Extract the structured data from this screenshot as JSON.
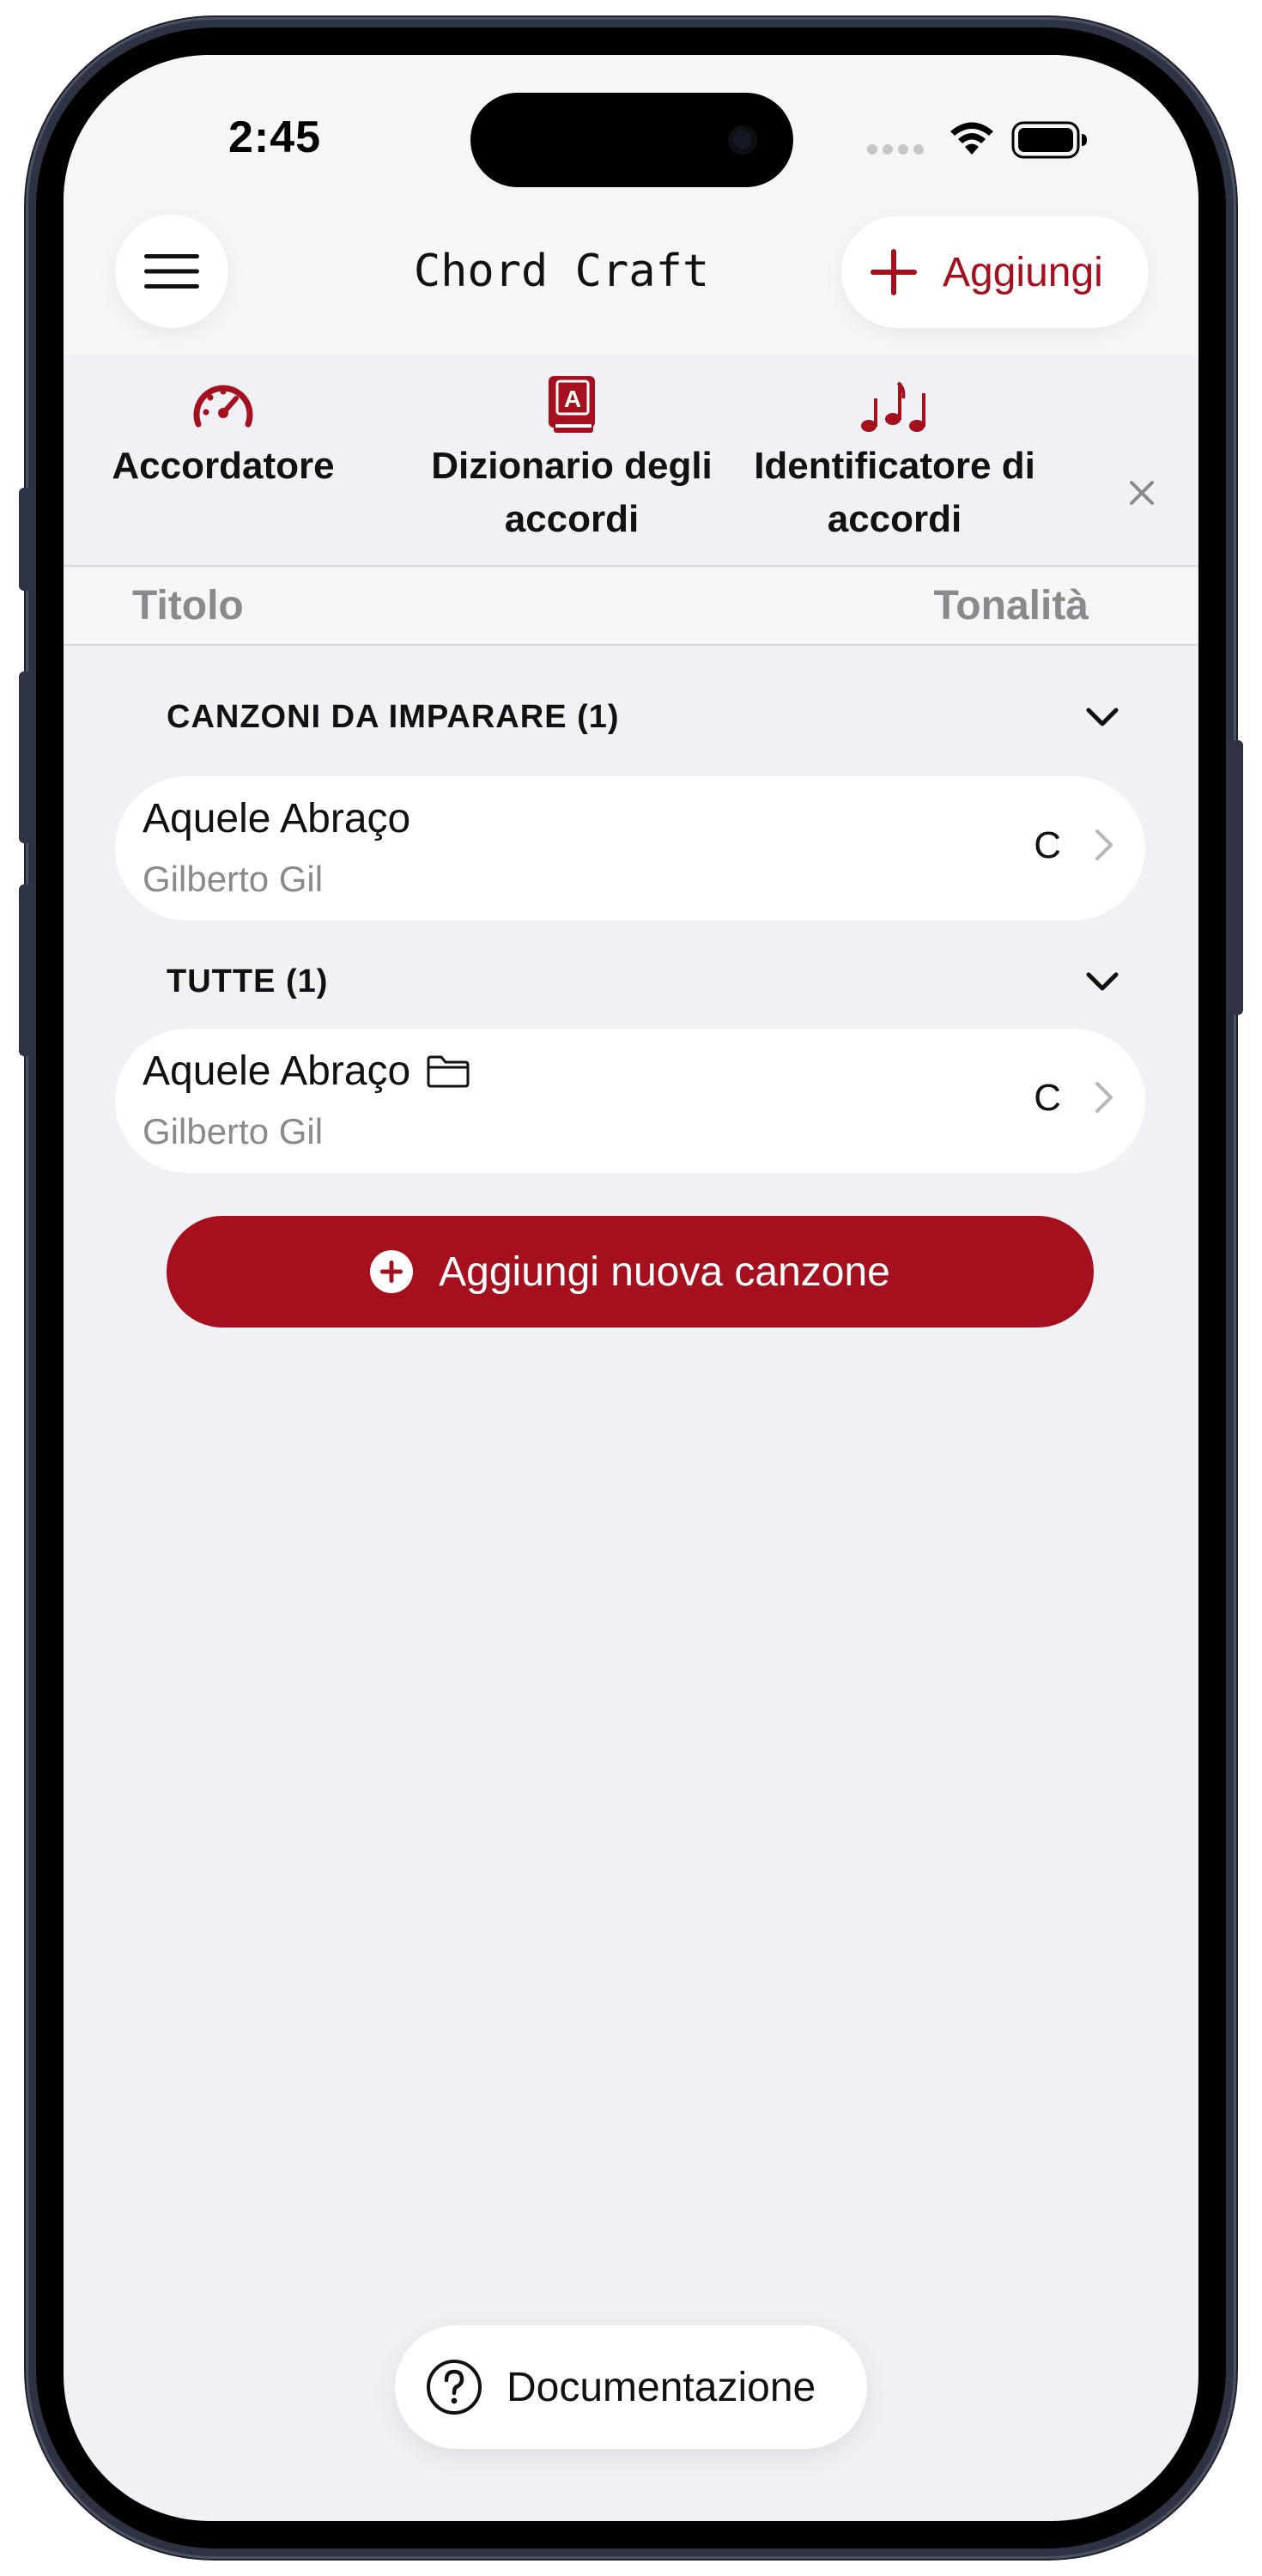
{
  "status_bar": {
    "time": "2:45"
  },
  "header": {
    "title": "Chord Craft",
    "add_label": "Aggiungi",
    "menu_icon": "hamburger-icon",
    "add_icon": "plus-icon"
  },
  "tools": [
    {
      "label_line1": "Accordatore",
      "label_line2": "",
      "icon": "tuner-gauge-icon"
    },
    {
      "label_line1": "Dizionario degli",
      "label_line2": "accordi",
      "icon": "chord-book-icon"
    },
    {
      "label_line1": "Identificatore di",
      "label_line2": "accordi",
      "icon": "music-notes-icon"
    }
  ],
  "columns": {
    "title": "Titolo",
    "key": "Tonalità"
  },
  "sections": [
    {
      "label": "CANZONI DA IMPARARE (1)",
      "songs": [
        {
          "title": "Aquele Abraço",
          "artist": "Gilberto Gil",
          "key": "C",
          "has_folder": false
        }
      ]
    },
    {
      "label": "TUTTE (1)",
      "songs": [
        {
          "title": "Aquele Abraço",
          "artist": "Gilberto Gil",
          "key": "C",
          "has_folder": true
        }
      ]
    }
  ],
  "new_song_button": {
    "label": "Aggiungi nuova canzone",
    "icon": "plus-circle-icon"
  },
  "docs_button": {
    "label": "Documentazione",
    "icon": "question-circle-icon"
  },
  "colors": {
    "accent": "#a50f1e",
    "background": "#f0f0f5",
    "secondary_text": "#8a8a8e"
  }
}
